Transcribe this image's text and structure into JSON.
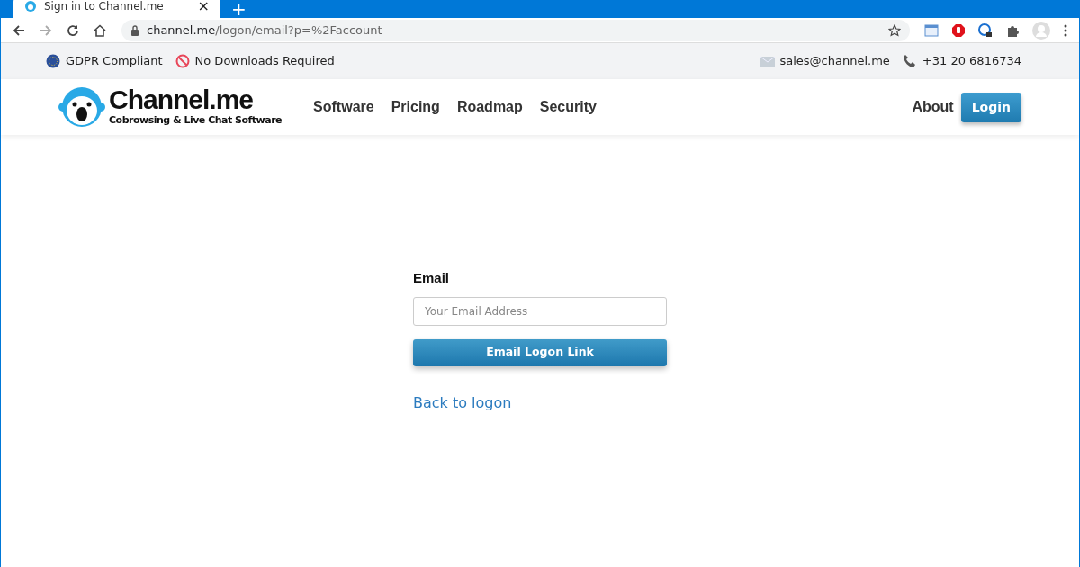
{
  "browser": {
    "tab": {
      "title": "Sign in to Channel.me",
      "close": "×"
    },
    "new_tab": "+",
    "url": {
      "host": "channel.me",
      "path": "/logon/email?p=%2Faccount"
    }
  },
  "info_bar": {
    "left": [
      {
        "kind": "eu",
        "text": "GDPR Compliant"
      },
      {
        "kind": "no",
        "text": "No Downloads Required"
      }
    ],
    "right": [
      {
        "kind": "mail",
        "text": "sales@channel.me"
      },
      {
        "kind": "phone",
        "text": "+31 20 6816734"
      }
    ]
  },
  "header": {
    "brand": "Channel.me",
    "tagline": "Cobrowsing & Live Chat Software",
    "nav": [
      "Software",
      "Pricing",
      "Roadmap",
      "Security"
    ],
    "about": "About",
    "login": "Login"
  },
  "form": {
    "label": "Email",
    "placeholder": "Your Email Address",
    "button": "Email Logon Link",
    "back_link": "Back to logon"
  }
}
